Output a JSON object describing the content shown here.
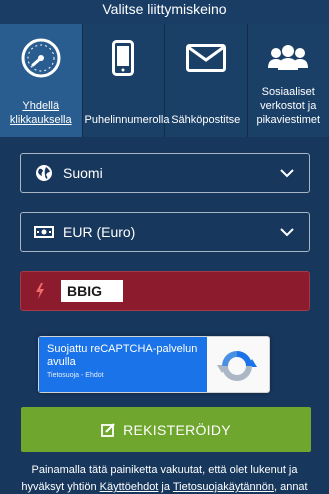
{
  "header": {
    "title": "Valitse liittymiskeino"
  },
  "tabs": [
    {
      "label": "Yhdellä klikkauksella",
      "icon": "speedometer-icon",
      "active": true
    },
    {
      "label": "Puhelinnumerolla",
      "icon": "phone-icon",
      "active": false
    },
    {
      "label": "Sähköpostitse",
      "icon": "envelope-icon",
      "active": false
    },
    {
      "label": "Sosiaaliset verkostot ja pikaviestimet",
      "icon": "people-icon",
      "active": false
    }
  ],
  "form": {
    "country": {
      "value": "Suomi",
      "icon": "globe-icon"
    },
    "currency": {
      "value": "EUR (Euro)",
      "icon": "banknote-icon"
    },
    "promo": {
      "value": "BBIG",
      "icon": "lightning-icon"
    },
    "captcha": {
      "text": "Suojattu reCAPTCHA-palvelun avulla",
      "privacy": "Tietosuoja",
      "separator": " - ",
      "terms": "Ehdot"
    },
    "register_label": "REKISTERÖIDY"
  },
  "disclaimer": {
    "text_before": "Painamalla tätä painiketta vakuutat, että olet lukenut ja hyväksyt yhtiön ",
    "link1": "Käyttöehdot",
    "between": " ja ",
    "link2": "Tietosuojakäytännön",
    "text_after": ", annat"
  },
  "colors": {
    "background": "#16375d",
    "active_tab": "#2a5d8f",
    "promo": "#8d1b2e",
    "register": "#6fa62e",
    "captcha_blue": "#1a73e8"
  }
}
